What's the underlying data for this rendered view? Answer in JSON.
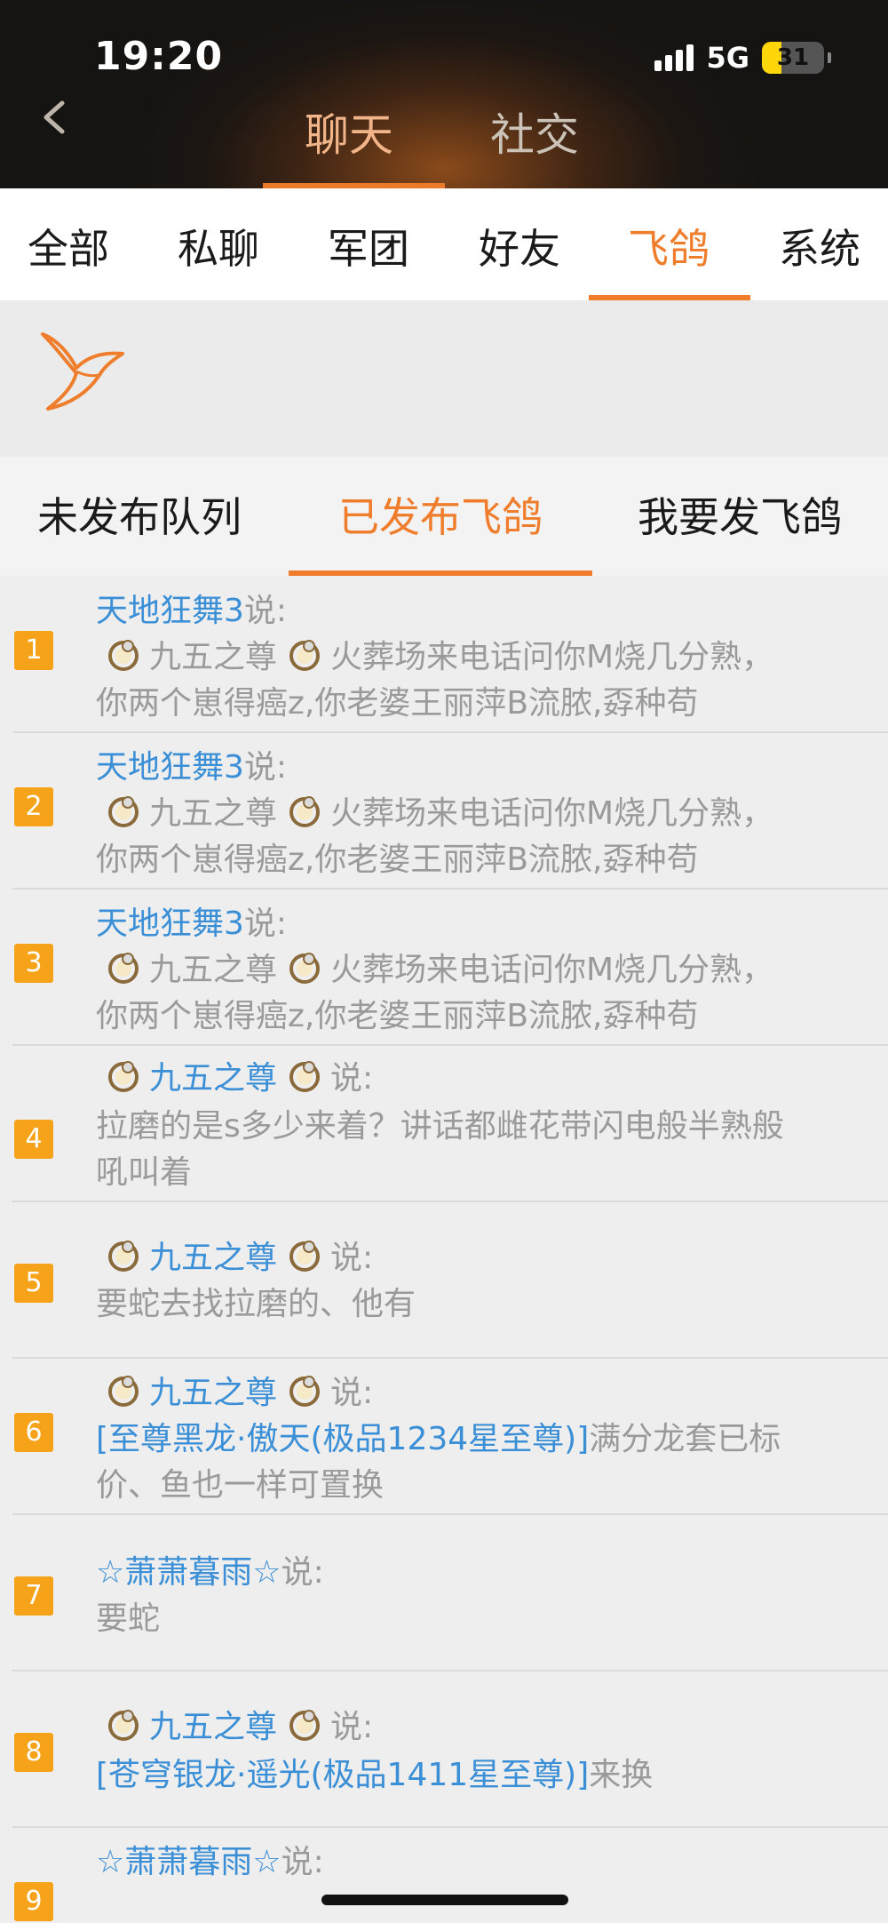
{
  "status": {
    "time": "19:20",
    "network": "5G",
    "battery": "31",
    "battery_level": 0.31
  },
  "top_tabs": {
    "chat": "聊天",
    "social": "社交"
  },
  "categories": [
    "全部",
    "私聊",
    "军团",
    "好友",
    "飞鸽",
    "系统"
  ],
  "sub_tabs": [
    "未发布队列",
    "已发布飞鸽",
    "我要发飞鸽"
  ],
  "messages": [
    {
      "no": "1",
      "sender": "天地狂舞3",
      "said": "说:",
      "line2_name": "九五之尊",
      "line2_text": "火葬场来电话问你M烧几分熟，",
      "line3": "你两个崽得癌z,你老婆王丽萍B流脓,孬种苟"
    },
    {
      "no": "2",
      "sender": "天地狂舞3",
      "said": "说:",
      "line2_name": "九五之尊",
      "line2_text": "火葬场来电话问你M烧几分熟，",
      "line3": "你两个崽得癌z,你老婆王丽萍B流脓,孬种苟"
    },
    {
      "no": "3",
      "sender": "天地狂舞3",
      "said": "说:",
      "line2_name": "九五之尊",
      "line2_text": "火葬场来电话问你M烧几分熟，",
      "line3": "你两个崽得癌z,你老婆王丽萍B流脓,孬种苟"
    },
    {
      "no": "4",
      "sender": "九五之尊",
      "said": "说:",
      "line2": "拉磨的是s多少来着？讲话都雌花带闪电般半熟般",
      "line3": "吼叫着"
    },
    {
      "no": "5",
      "sender": "九五之尊",
      "said": "说:",
      "line2": "要蛇去找拉磨的、他有"
    },
    {
      "no": "6",
      "sender": "九五之尊",
      "said": "说:",
      "line2_link": "[至尊黑龙·傲天(极品1234星至尊)]",
      "line2_text": "满分龙套已标",
      "line3": "价、鱼也一样可置换"
    },
    {
      "no": "7",
      "sender": "☆萧萧暮雨☆",
      "said": "说:",
      "line2": "要蛇"
    },
    {
      "no": "8",
      "sender": "九五之尊",
      "said": "说:",
      "line2_link": "[苍穹银龙·遥光(极品1411星至尊)]",
      "line2_text": "来换"
    },
    {
      "no": "9",
      "sender": "☆萧萧暮雨☆",
      "said": "说:"
    }
  ]
}
